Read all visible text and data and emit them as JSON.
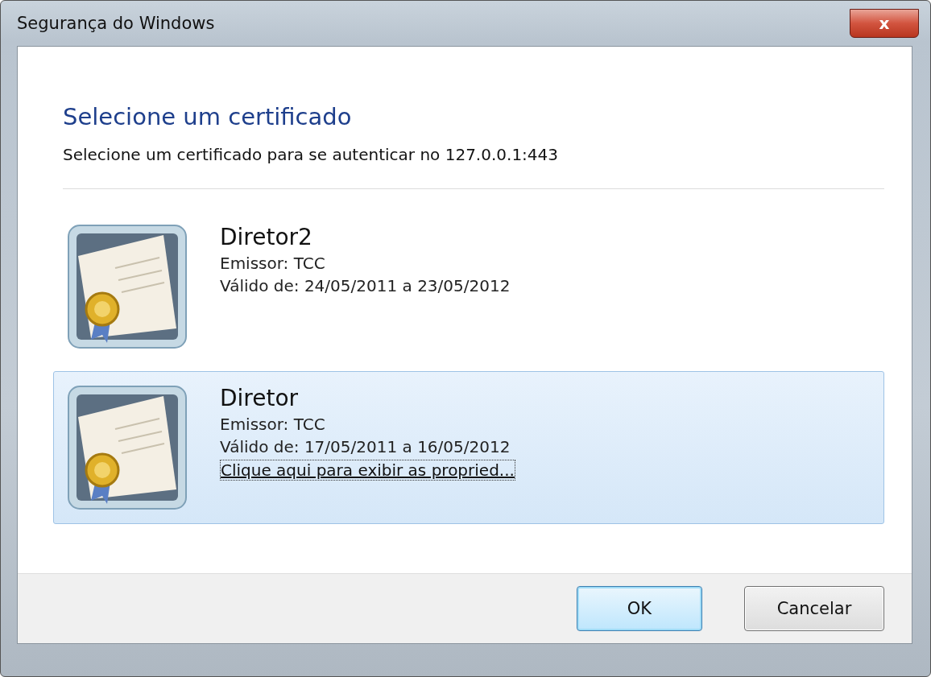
{
  "window": {
    "title": "Segurança do Windows",
    "close_label": "x"
  },
  "heading": "Selecione um certificado",
  "subtitle": "Selecione um certificado para se autenticar no 127.0.0.1:443",
  "certificates": [
    {
      "name": "Diretor2",
      "issuer": "Emissor: TCC",
      "validity": "Válido de: 24/05/2011 a 23/05/2012",
      "selected": false
    },
    {
      "name": "Diretor",
      "issuer": "Emissor: TCC",
      "validity": "Válido de: 17/05/2011 a 16/05/2012",
      "selected": true,
      "details_link": "Clique aqui para exibir as propried..."
    }
  ],
  "buttons": [
    {
      "label": "OK",
      "default": true
    },
    {
      "label": "Cancelar",
      "default": false
    }
  ]
}
